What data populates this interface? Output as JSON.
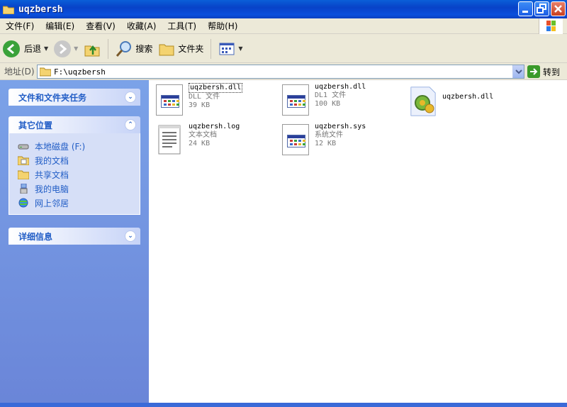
{
  "window": {
    "title": "uqzbersh"
  },
  "menu": [
    "文件(F)",
    "编辑(E)",
    "查看(V)",
    "收藏(A)",
    "工具(T)",
    "帮助(H)"
  ],
  "toolbar": {
    "back": "后退",
    "search": "搜索",
    "folders": "文件夹"
  },
  "address": {
    "label": "地址(D)",
    "path": "F:\\uqzbersh",
    "go": "转到"
  },
  "sidebar": {
    "tasks_title": "文件和文件夹任务",
    "places_title": "其它位置",
    "places": [
      {
        "label": "本地磁盘 (F:)",
        "icon": "drive-icon"
      },
      {
        "label": "我的文档",
        "icon": "my-documents-icon"
      },
      {
        "label": "共享文档",
        "icon": "shared-folder-icon"
      },
      {
        "label": "我的电脑",
        "icon": "my-computer-icon"
      },
      {
        "label": "网上邻居",
        "icon": "network-icon"
      }
    ],
    "details_title": "详细信息"
  },
  "files": [
    {
      "name": "uqzbersh.dll",
      "type": "DLL 文件",
      "size": "39 KB",
      "icon": "dll-file-icon",
      "selected": true
    },
    {
      "name": "uqzbersh.dll",
      "type": "DL1 文件",
      "size": "100 KB",
      "icon": "dll-file-icon",
      "selected": false
    },
    {
      "name": "uqzbersh.dll",
      "type": "",
      "size": "",
      "icon": "settings-file-icon",
      "selected": false
    },
    {
      "name": "uqzbersh.log",
      "type": "文本文档",
      "size": "24 KB",
      "icon": "text-document-icon",
      "selected": false
    },
    {
      "name": "uqzbersh.sys",
      "type": "系统文件",
      "size": "12 KB",
      "icon": "sys-file-icon",
      "selected": false
    }
  ]
}
